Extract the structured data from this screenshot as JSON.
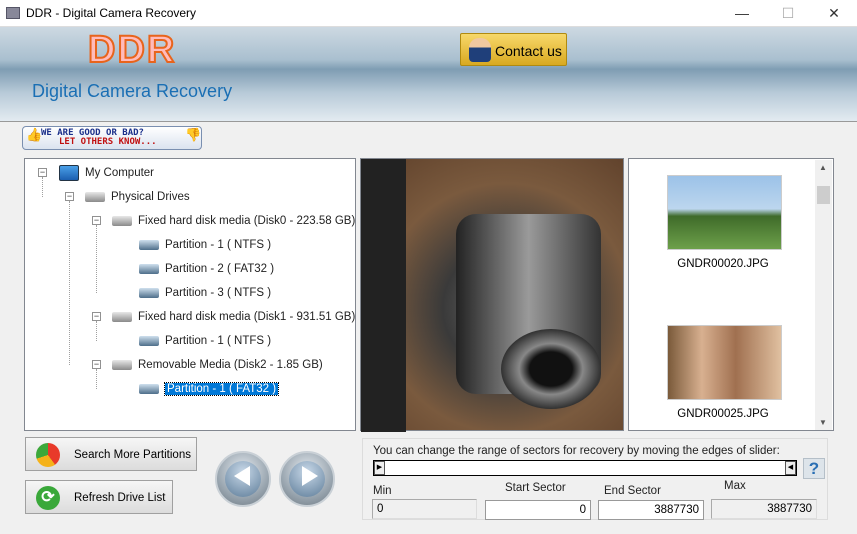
{
  "window": {
    "title": "DDR - Digital Camera Recovery",
    "minimize": "—",
    "maximize": "☐",
    "close": "✕"
  },
  "banner": {
    "logo": "DDR",
    "subtitle": "Digital Camera Recovery",
    "contact_label": "Contact us"
  },
  "feedback": {
    "line1": "WE ARE GOOD OR BAD?",
    "line2": "LET OTHERS KNOW..."
  },
  "tree": [
    {
      "label": "My Computer",
      "level": 0,
      "icon": "computer-icon"
    },
    {
      "label": "Physical Drives",
      "level": 1,
      "icon": "drive-icon"
    },
    {
      "label": "Fixed hard disk media (Disk0 - 223.58 GB)",
      "level": 2,
      "icon": "hard-disk-icon"
    },
    {
      "label": "Partition - 1 ( NTFS )",
      "level": 3,
      "icon": "partition-icon"
    },
    {
      "label": "Partition - 2 ( FAT32 )",
      "level": 3,
      "icon": "partition-icon"
    },
    {
      "label": "Partition - 3 ( NTFS )",
      "level": 3,
      "icon": "partition-icon"
    },
    {
      "label": "Fixed hard disk media (Disk1 - 931.51 GB)",
      "level": 2,
      "icon": "hard-disk-icon"
    },
    {
      "label": "Partition - 1 ( NTFS )",
      "level": 3,
      "icon": "partition-icon"
    },
    {
      "label": "Removable Media (Disk2 - 1.85 GB)",
      "level": 2,
      "icon": "removable-disk-icon"
    },
    {
      "label": "Partition - 1 ( FAT32 )",
      "level": 3,
      "icon": "partition-icon",
      "selected": true
    }
  ],
  "thumbnails": [
    {
      "name": "GNDR00020.JPG"
    },
    {
      "name": "GNDR00025.JPG"
    }
  ],
  "buttons": {
    "search": "Search More Partitions",
    "refresh": "Refresh Drive List"
  },
  "sector": {
    "message": "You can change the range of sectors for recovery by moving the edges of slider:",
    "help": "?",
    "min_label": "Min",
    "start_label": "Start Sector",
    "end_label": "End Sector",
    "max_label": "Max",
    "min": "0",
    "start": "0",
    "end": "3887730",
    "max": "3887730"
  }
}
